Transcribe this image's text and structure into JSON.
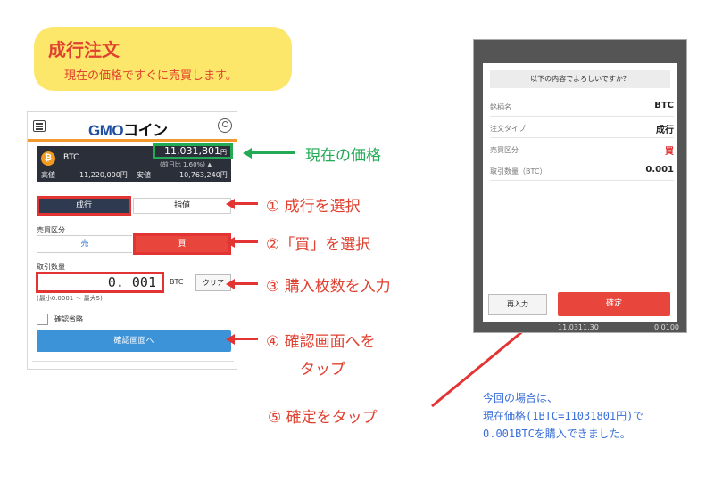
{
  "title": {
    "main": "成行注文",
    "sub": "現在の価格ですぐに売買します。"
  },
  "app": {
    "logo_prefix": "GMO",
    "logo_suffix": "コイン",
    "coin_symbol": "₿",
    "coin_name": "BTC",
    "price": "11,031,801",
    "price_unit": "円",
    "change": "(前日比 1.60%) ▲",
    "high_label": "高値",
    "high_value": "11,220,000円",
    "low_label": "安値",
    "low_value": "10,763,240円",
    "tab_market": "成行",
    "tab_limit": "指値",
    "side_label": "売買区分",
    "sell_label": "売",
    "buy_label": "買",
    "qty_label": "取引数量",
    "qty_value": "0. 001",
    "qty_unit": "BTC",
    "clear_label": "クリア",
    "qty_hint": "(最小0.0001 〜 最大5)",
    "skip_confirm_label": "確認省略",
    "confirm_button": "確認画面へ"
  },
  "annotations": {
    "price": "現在の価格",
    "step1": "①  成行を選択",
    "step2": "②「買」を選択",
    "step3": "③  購入枚数を入力",
    "step4_line1": "④  確認画面へを",
    "step4_line2": "タップ",
    "step5": "⑤  確定をタップ"
  },
  "dialog": {
    "title": "以下の内容でよろしいですか？",
    "rows": [
      {
        "label": "銘柄名",
        "value": "BTC"
      },
      {
        "label": "注文タイプ",
        "value": "成行"
      },
      {
        "label": "売買区分",
        "value": "買"
      },
      {
        "label": "取引数量（BTC）",
        "value": "0.001"
      }
    ],
    "reenter_button": "再入力",
    "ok_button": "確定",
    "under_left": "11,0311.30",
    "under_right": "0.0100"
  },
  "note": {
    "line1": "今回の場合は、",
    "line2": "現在価格(1BTC=11031801円)で",
    "line3": "0.001BTCを購入できました。"
  },
  "colors": {
    "accent_red": "#e33434",
    "accent_green": "#22aa55",
    "note_blue": "#3a6fd8",
    "title_bg": "#fde76a"
  }
}
